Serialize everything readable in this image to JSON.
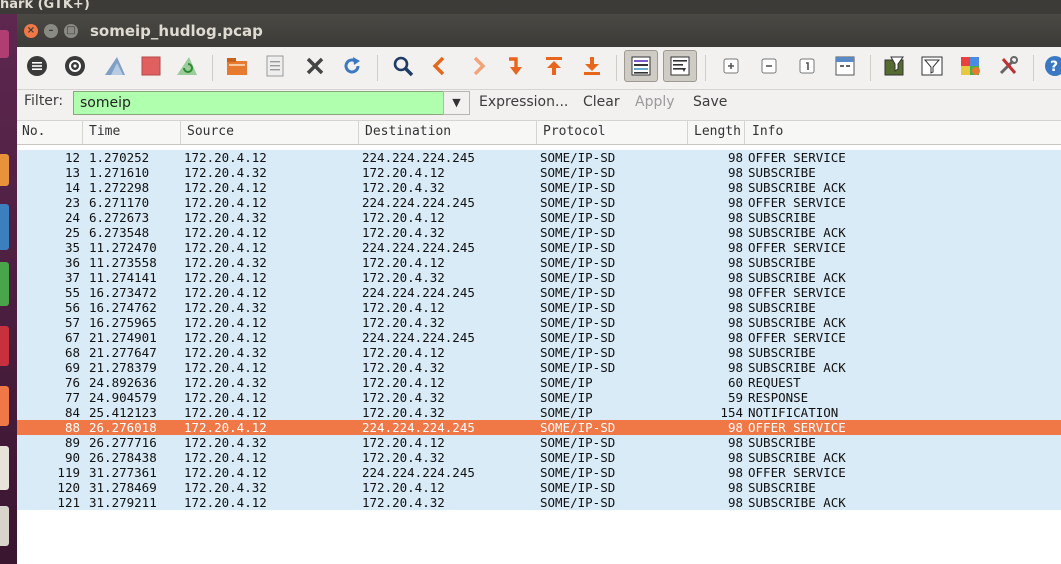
{
  "app_title": "hark (GTK+)",
  "window": {
    "title": "someip_hudlog.pcap",
    "close": "×",
    "min": "–",
    "max": "□"
  },
  "toolbar": {
    "icons": [
      "interface-list-icon",
      "capture-options-icon",
      "start-capture-icon",
      "stop-capture-icon",
      "restart-capture-icon",
      "open-file-icon",
      "save-file-icon",
      "close-file-icon",
      "reload-icon",
      "find-packet-icon",
      "go-back-icon",
      "go-forward-icon",
      "go-to-packet-icon",
      "go-first-icon",
      "go-last-icon",
      "colorize-icon",
      "auto-scroll-icon",
      "zoom-in-icon",
      "zoom-out-icon",
      "normal-size-icon",
      "resize-columns-icon",
      "capture-filters-icon",
      "display-filters-icon",
      "coloring-rules-icon",
      "preferences-icon",
      "help-icon"
    ],
    "accent": "#f07746"
  },
  "filter": {
    "label": "Filter:",
    "value": "someip",
    "dropdown": "▼",
    "expression": "Expression...",
    "clear": "Clear",
    "apply": "Apply",
    "save": "Save",
    "valid_color": "#afffaf"
  },
  "columns": [
    "No.",
    "Time",
    "Source",
    "Destination",
    "Protocol",
    "Length",
    "Info"
  ],
  "packets": [
    {
      "no": "12",
      "time": "1.270252",
      "src": "172.20.4.12",
      "dst": "224.224.224.245",
      "proto": "SOME/IP-SD",
      "len": "98",
      "info": "OFFER SERVICE"
    },
    {
      "no": "13",
      "time": "1.271610",
      "src": "172.20.4.32",
      "dst": "172.20.4.12",
      "proto": "SOME/IP-SD",
      "len": "98",
      "info": "SUBSCRIBE"
    },
    {
      "no": "14",
      "time": "1.272298",
      "src": "172.20.4.12",
      "dst": "172.20.4.32",
      "proto": "SOME/IP-SD",
      "len": "98",
      "info": "SUBSCRIBE ACK"
    },
    {
      "no": "23",
      "time": "6.271170",
      "src": "172.20.4.12",
      "dst": "224.224.224.245",
      "proto": "SOME/IP-SD",
      "len": "98",
      "info": "OFFER SERVICE"
    },
    {
      "no": "24",
      "time": "6.272673",
      "src": "172.20.4.32",
      "dst": "172.20.4.12",
      "proto": "SOME/IP-SD",
      "len": "98",
      "info": "SUBSCRIBE"
    },
    {
      "no": "25",
      "time": "6.273548",
      "src": "172.20.4.12",
      "dst": "172.20.4.32",
      "proto": "SOME/IP-SD",
      "len": "98",
      "info": "SUBSCRIBE ACK"
    },
    {
      "no": "35",
      "time": "11.272470",
      "src": "172.20.4.12",
      "dst": "224.224.224.245",
      "proto": "SOME/IP-SD",
      "len": "98",
      "info": "OFFER SERVICE"
    },
    {
      "no": "36",
      "time": "11.273558",
      "src": "172.20.4.32",
      "dst": "172.20.4.12",
      "proto": "SOME/IP-SD",
      "len": "98",
      "info": "SUBSCRIBE"
    },
    {
      "no": "37",
      "time": "11.274141",
      "src": "172.20.4.12",
      "dst": "172.20.4.32",
      "proto": "SOME/IP-SD",
      "len": "98",
      "info": "SUBSCRIBE ACK"
    },
    {
      "no": "55",
      "time": "16.273472",
      "src": "172.20.4.12",
      "dst": "224.224.224.245",
      "proto": "SOME/IP-SD",
      "len": "98",
      "info": "OFFER SERVICE"
    },
    {
      "no": "56",
      "time": "16.274762",
      "src": "172.20.4.32",
      "dst": "172.20.4.12",
      "proto": "SOME/IP-SD",
      "len": "98",
      "info": "SUBSCRIBE"
    },
    {
      "no": "57",
      "time": "16.275965",
      "src": "172.20.4.12",
      "dst": "172.20.4.32",
      "proto": "SOME/IP-SD",
      "len": "98",
      "info": "SUBSCRIBE ACK"
    },
    {
      "no": "67",
      "time": "21.274901",
      "src": "172.20.4.12",
      "dst": "224.224.224.245",
      "proto": "SOME/IP-SD",
      "len": "98",
      "info": "OFFER SERVICE"
    },
    {
      "no": "68",
      "time": "21.277647",
      "src": "172.20.4.32",
      "dst": "172.20.4.12",
      "proto": "SOME/IP-SD",
      "len": "98",
      "info": "SUBSCRIBE"
    },
    {
      "no": "69",
      "time": "21.278379",
      "src": "172.20.4.12",
      "dst": "172.20.4.32",
      "proto": "SOME/IP-SD",
      "len": "98",
      "info": "SUBSCRIBE ACK"
    },
    {
      "no": "76",
      "time": "24.892636",
      "src": "172.20.4.32",
      "dst": "172.20.4.12",
      "proto": "SOME/IP",
      "len": "60",
      "info": "REQUEST"
    },
    {
      "no": "77",
      "time": "24.904579",
      "src": "172.20.4.12",
      "dst": "172.20.4.32",
      "proto": "SOME/IP",
      "len": "59",
      "info": "RESPONSE"
    },
    {
      "no": "84",
      "time": "25.412123",
      "src": "172.20.4.12",
      "dst": "172.20.4.32",
      "proto": "SOME/IP",
      "len": "154",
      "info": "NOTIFICATION"
    },
    {
      "no": "88",
      "time": "26.276018",
      "src": "172.20.4.12",
      "dst": "224.224.224.245",
      "proto": "SOME/IP-SD",
      "len": "98",
      "info": "OFFER SERVICE",
      "selected": true
    },
    {
      "no": "89",
      "time": "26.277716",
      "src": "172.20.4.32",
      "dst": "172.20.4.12",
      "proto": "SOME/IP-SD",
      "len": "98",
      "info": "SUBSCRIBE"
    },
    {
      "no": "90",
      "time": "26.278438",
      "src": "172.20.4.12",
      "dst": "172.20.4.32",
      "proto": "SOME/IP-SD",
      "len": "98",
      "info": "SUBSCRIBE ACK"
    },
    {
      "no": "119",
      "time": "31.277361",
      "src": "172.20.4.12",
      "dst": "224.224.224.245",
      "proto": "SOME/IP-SD",
      "len": "98",
      "info": "OFFER SERVICE"
    },
    {
      "no": "120",
      "time": "31.278469",
      "src": "172.20.4.32",
      "dst": "172.20.4.12",
      "proto": "SOME/IP-SD",
      "len": "98",
      "info": "SUBSCRIBE"
    },
    {
      "no": "121",
      "time": "31.279211",
      "src": "172.20.4.12",
      "dst": "172.20.4.32",
      "proto": "SOME/IP-SD",
      "len": "98",
      "info": "SUBSCRIBE ACK"
    }
  ]
}
